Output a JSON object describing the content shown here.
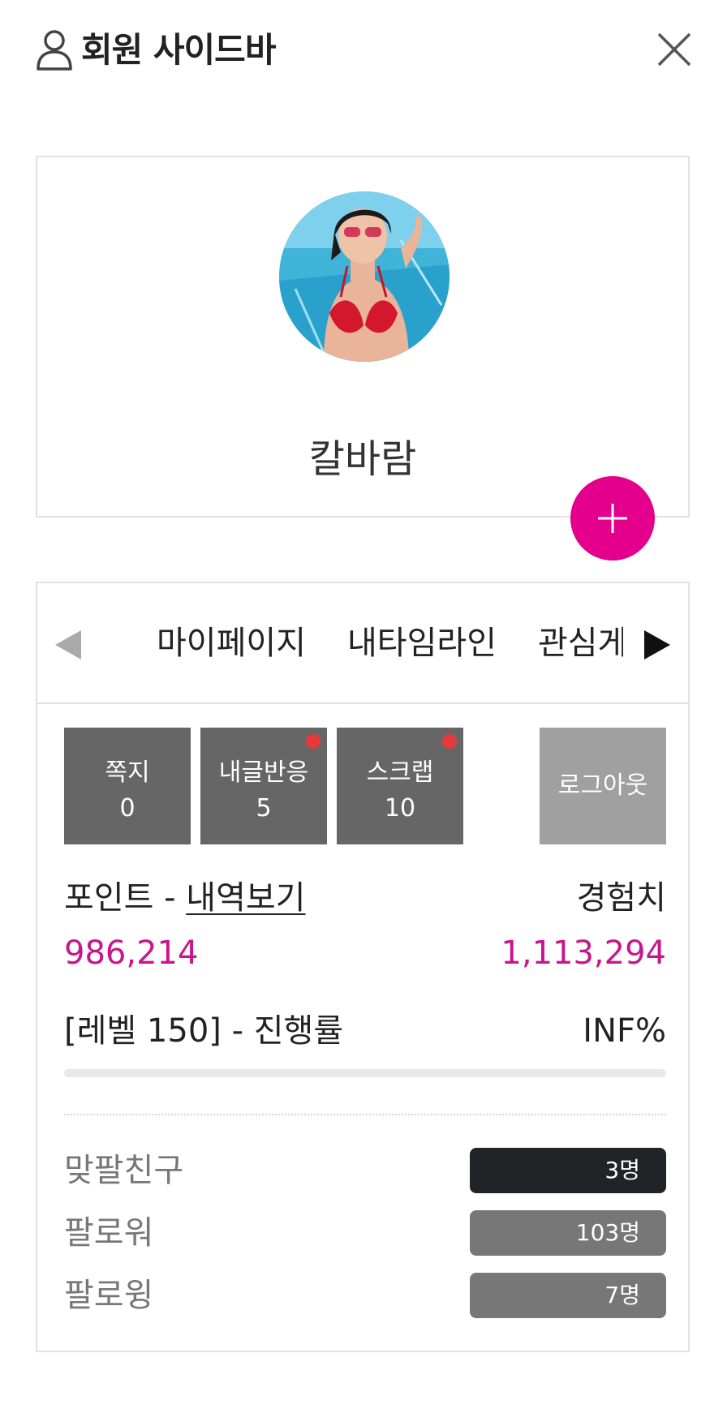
{
  "header": {
    "title": "회원 사이드바"
  },
  "profile": {
    "nickname": "칼바람"
  },
  "tabs": [
    "마이페이지",
    "내타임라인",
    "관심게시"
  ],
  "quick": [
    {
      "label": "쪽지",
      "count": "0",
      "dot": false
    },
    {
      "label": "내글반응",
      "count": "5",
      "dot": true
    },
    {
      "label": "스크랩",
      "count": "10",
      "dot": true
    }
  ],
  "logout_label": "로그아웃",
  "points": {
    "label": "포인트 - ",
    "link": "내역보기",
    "value": "986,214"
  },
  "exp": {
    "label": "경험치",
    "value": "1,113,294"
  },
  "level": {
    "label": "[레벨 150] - 진행률",
    "progress_text": "INF%",
    "progress_fraction": 0
  },
  "stats": [
    {
      "label": "맞팔친구",
      "value": "3명",
      "color": "#222326"
    },
    {
      "label": "팔로워",
      "value": "103명",
      "color": "#777777"
    },
    {
      "label": "팔로윙",
      "value": "7명",
      "color": "#777777"
    }
  ],
  "colors": {
    "accent": "#e4008c",
    "value_pink": "#c7168c",
    "notify_dot": "#e63a3a"
  }
}
